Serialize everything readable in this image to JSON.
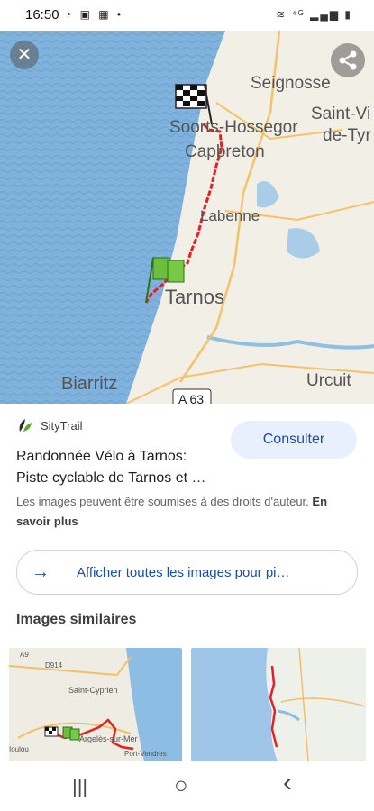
{
  "status_bar": {
    "time": "16:50",
    "left_icons": "◔ ▣ ▦ •",
    "right_icons": "≋ ⁴ᴳ ▂▄▆ ▮"
  },
  "hero_map": {
    "labels": [
      "Seignosse",
      "Soorts-Hossegor",
      "Saint-Vi",
      "de-Tyr",
      "Capbreton",
      "Labenne",
      "Tarnos",
      "Biarritz",
      "Urcuit",
      "A 63"
    ],
    "colors": {
      "sea": "#7fb2dc",
      "land": "#f1efe6",
      "route": "#e32122"
    }
  },
  "source": {
    "name": "SityTrail"
  },
  "title": {
    "line1": "Randonnée Vélo à Tarnos:",
    "line2": "Piste cyclable de Tarnos et …"
  },
  "consult_button": "Consulter",
  "notice": {
    "text": "Les images peuvent être soumises à des droits d'auteur.",
    "link": "En savoir plus"
  },
  "all_images_button": "Afficher toutes les images pour pi…",
  "similar": {
    "heading": "Images similaires",
    "thumb1_labels": [
      "A9",
      "D914",
      "Saint-Cyprien",
      "Argelès-sur-Mer",
      "Port-Vendres",
      "Ioulou"
    ]
  },
  "navbar": {
    "recent": "|||",
    "home": "○",
    "back": "‹"
  }
}
